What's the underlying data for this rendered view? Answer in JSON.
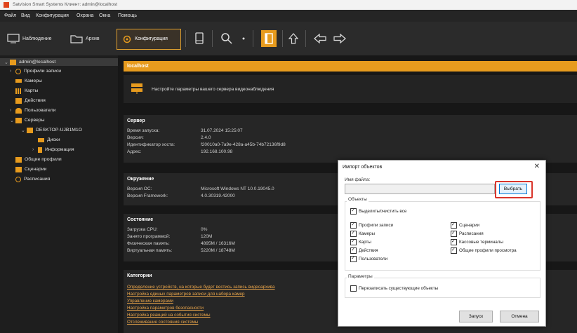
{
  "window": {
    "title": "Satvision Smart Systems Клиент: admin@localhost"
  },
  "menu": [
    "Файл",
    "Вид",
    "Конфигурация",
    "Охрана",
    "Окна",
    "Помощь"
  ],
  "toolbar": {
    "observe": "Наблюдение",
    "archive": "Архив",
    "config": "Конфигурация"
  },
  "tree": {
    "root": "admin@localhost",
    "profiles": "Профили записи",
    "cameras": "Камеры",
    "maps": "Карты",
    "actions": "Действия",
    "users": "Пользователи",
    "servers": "Серверы",
    "desktop": "DESKTOP-UJB1M1O",
    "disks": "Диски",
    "info": "Информация",
    "common": "Общие профили",
    "scenarios": "Сценарии",
    "schedules": "Расписания"
  },
  "main": {
    "header": "localhost",
    "hint": "Настройте параметры вашего сервера видеонаблюдения",
    "server": {
      "title": "Сервер",
      "rows": [
        {
          "k": "Время запуска:",
          "v": "31.07.2024 15:25:07"
        },
        {
          "k": "Версия:",
          "v": "2.4.0"
        },
        {
          "k": "Идентификатор хоста:",
          "v": "f20010a0-7a9e-428a-a45b-74b72136f9d8"
        },
        {
          "k": "Адрес:",
          "v": "192.168.100.98"
        }
      ]
    },
    "env": {
      "title": "Окружение",
      "rows": [
        {
          "k": "Версия ОС:",
          "v": "Microsoft Windows NT 10.0.19045.0"
        },
        {
          "k": "Версия Framework:",
          "v": "4.0.30319.42000"
        }
      ]
    },
    "state": {
      "title": "Состояние",
      "rows": [
        {
          "k": "Загрузка CPU:",
          "v": "0%"
        },
        {
          "k": "Занято программой:",
          "v": "120M"
        },
        {
          "k": "Физическая память:",
          "v": "4895M / 16316M"
        },
        {
          "k": "Виртуальная память:",
          "v": "5220M / 18748M"
        }
      ]
    },
    "categories": {
      "title": "Категории",
      "links": [
        "Определение устройств, на которые будет вестись запись видеоархива",
        "Настройка единых параметров записи для набора камер",
        "Управление камерами",
        "Настройка параметров безопасности",
        "Настройка реакций на события системы",
        "Отслеживание состояния системы"
      ]
    }
  },
  "dialog": {
    "title": "Импорт объектов",
    "close": "✕",
    "file_label": "Имя файла:",
    "file_value": "",
    "browse": "Выбрать",
    "objects_label": "Объекты",
    "select_all": "Выделить/очистить все",
    "left_items": [
      "Профили записи",
      "Камеры",
      "Карты",
      "Действия",
      "Пользователи"
    ],
    "right_items": [
      "Сценарии",
      "Расписания",
      "Кассовые терминалы",
      "Общие профили просмотра"
    ],
    "params_label": "Параметры",
    "overwrite": "Перезаписать существующие объекты",
    "start": "Запуск",
    "cancel": "Отмена"
  },
  "colors": {
    "accent": "#e79b1e",
    "highlight": "#d9342b"
  }
}
